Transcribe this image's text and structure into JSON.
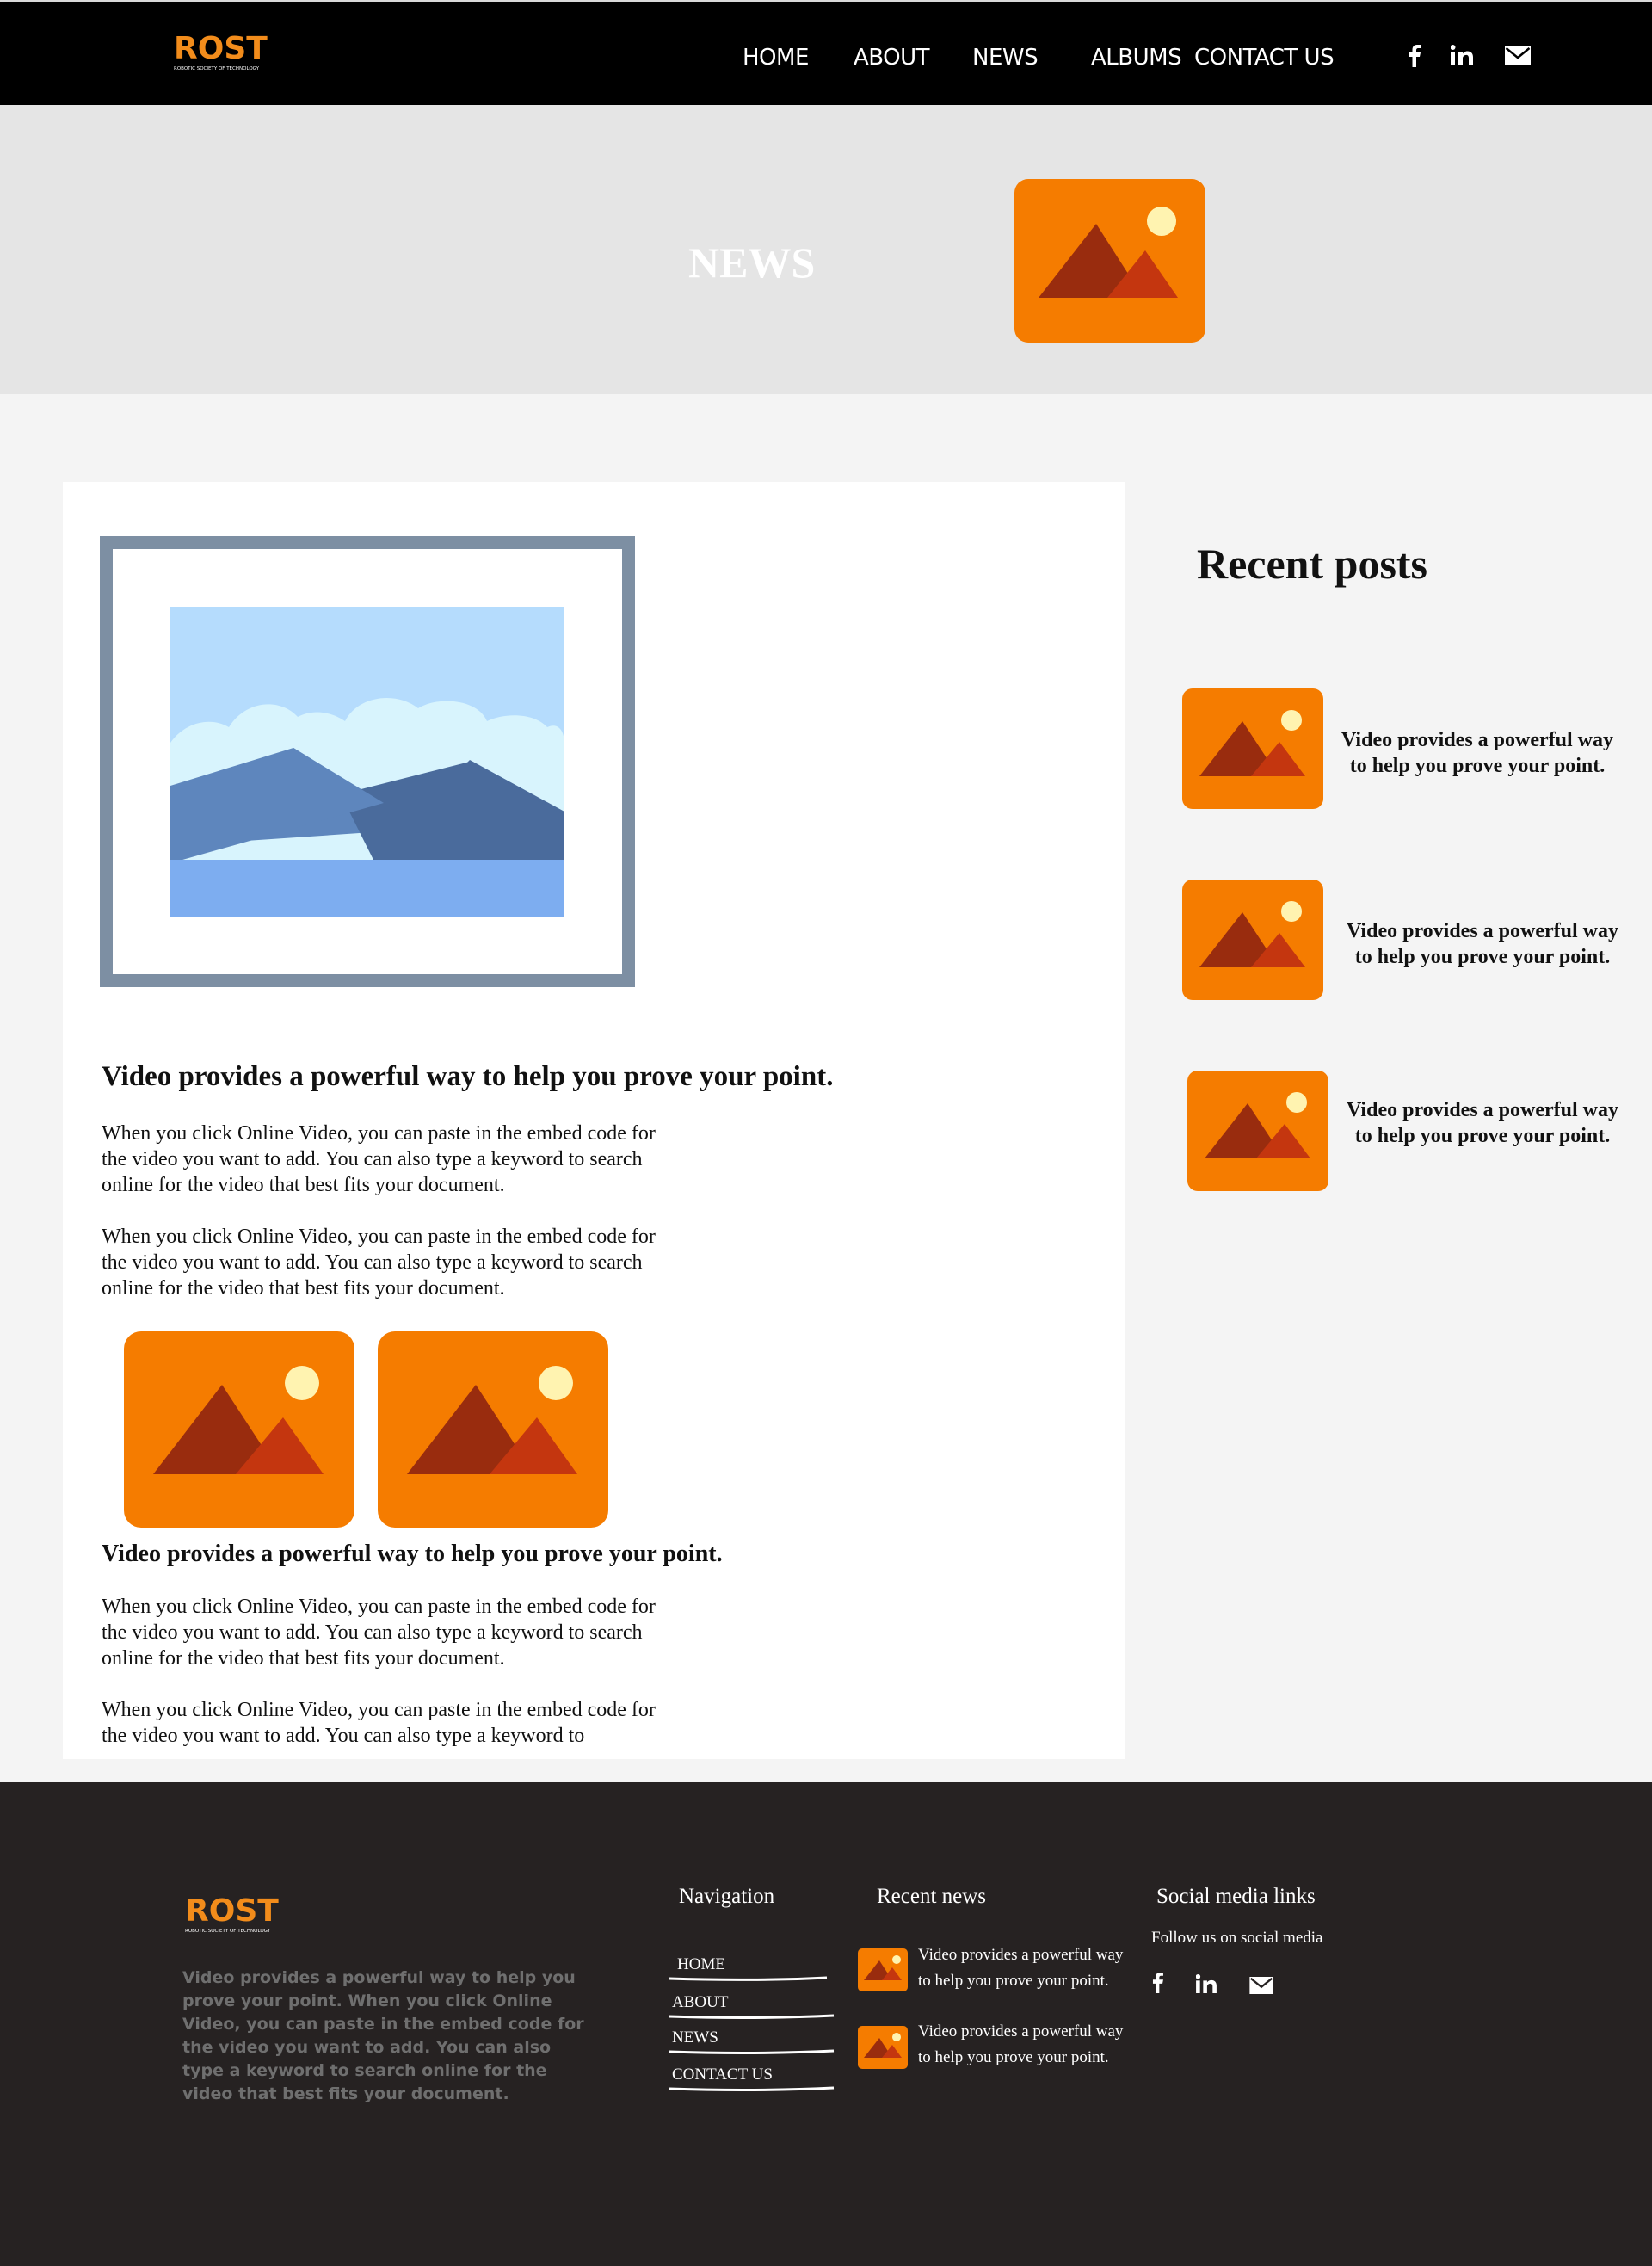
{
  "header": {
    "logo_text": "ROST",
    "logo_tagline": "ROBOTIC SOCIETY OF TECHNOLOGY",
    "nav": [
      "HOME",
      "ABOUT",
      "NEWS",
      "ALBUMS",
      "CONTACT US"
    ],
    "social_icons": [
      "facebook-icon",
      "linkedin-icon",
      "mail-icon"
    ]
  },
  "hero": {
    "title": "NEWS"
  },
  "article": {
    "sections": [
      {
        "heading": "Video provides a powerful way to help you prove your point.",
        "paragraphs": [
          "When you click Online Video, you can paste in the embed code for the video you want to add. You can also type a keyword to search online for the video that best fits your document.",
          "When you click Online Video, you can paste in the embed code for the video you want to add. You can also type a keyword to search online for the video that best fits your document."
        ]
      },
      {
        "heading": "Video provides a powerful way to help you prove your point.",
        "paragraphs": [
          "When you click Online Video, you can paste in the embed code for the video you want to add. You can also type a keyword to search online for the video that best fits your document.",
          "When you click Online Video, you can paste in the embed code for the video you want to add. You can also type a keyword to"
        ]
      }
    ]
  },
  "sidebar": {
    "title": "Recent posts",
    "posts": [
      "Video provides a powerful way to help you prove your point.",
      "Video provides a powerful way to help you prove your point.",
      "Video provides a powerful way to help you prove your point."
    ]
  },
  "footer": {
    "logo_text": "ROST",
    "logo_tagline": "ROBOTIC SOCIETY OF TECHNOLOGY",
    "description": "Video provides a powerful way to help you prove your point. When you click Online Video, you can paste in the embed code for the video you want to add. You can also type a keyword to search online for the video that best fits your document.",
    "navigation_title": "Navigation",
    "nav": [
      "HOME",
      "ABOUT",
      "NEWS",
      "CONTACT US"
    ],
    "recent_news_title": "Recent news",
    "recent_news": [
      "Video provides a powerful way to help you prove your point.",
      "Video provides a powerful way to help you prove your point."
    ],
    "social_title": "Social media links",
    "social_text": "Follow us on social media",
    "social_icons": [
      "facebook-icon",
      "linkedin-icon",
      "mail-icon"
    ]
  },
  "colors": {
    "accent_orange": "#F57C00",
    "header_bg": "#000000",
    "footer_bg": "#262222",
    "hero_bg": "#E5E5E5"
  }
}
